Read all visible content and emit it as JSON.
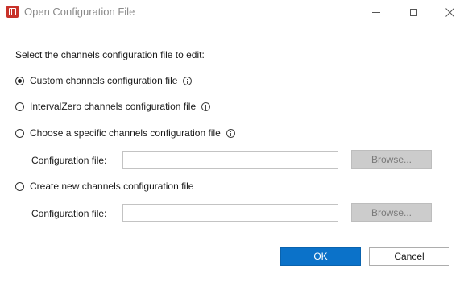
{
  "window": {
    "title": "Open Configuration File",
    "icon": "app-icon"
  },
  "dialog": {
    "prompt": "Select the channels configuration file to edit:",
    "options": [
      {
        "label": "Custom channels configuration file",
        "checked": true,
        "info": true
      },
      {
        "label": "IntervalZero channels configuration file",
        "checked": false,
        "info": true
      },
      {
        "label": "Choose a specific channels configuration file",
        "checked": false,
        "info": true
      },
      {
        "label": "Create new channels configuration file",
        "checked": false,
        "info": false
      }
    ],
    "specific_file": {
      "label": "Configuration file:",
      "value": "",
      "browse_label": "Browse..."
    },
    "new_file": {
      "label": "Configuration file:",
      "value": "",
      "browse_label": "Browse..."
    }
  },
  "buttons": {
    "ok_label": "OK",
    "cancel_label": "Cancel"
  }
}
